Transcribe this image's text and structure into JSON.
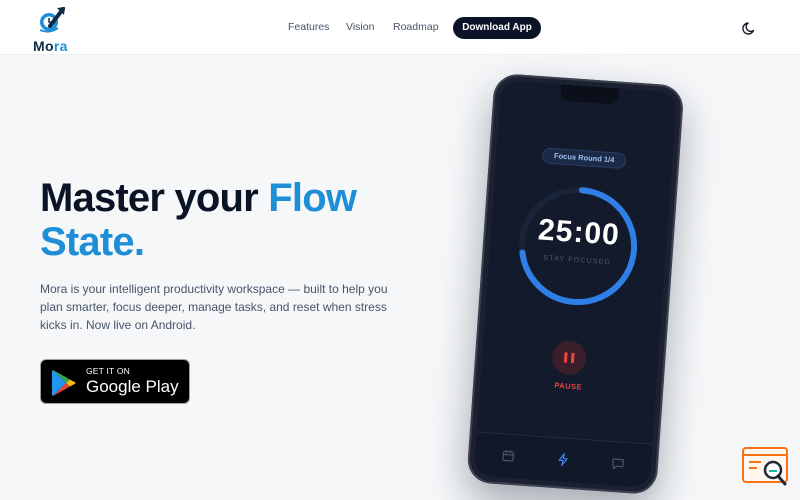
{
  "brand": {
    "name_main": "Mo",
    "name_accent": "ra"
  },
  "nav": {
    "items": [
      "Features",
      "Vision",
      "Roadmap"
    ],
    "cta": "Download App"
  },
  "hero": {
    "title_part1": "Master your ",
    "title_flow": "Flow",
    "title_state": "State",
    "title_dot": ".",
    "description": "Mora is your intelligent productivity workspace — built to help you plan smarter, focus deeper, manage tasks, and reset when stress kicks in. Now live on Android.",
    "store_small": "GET IT ON",
    "store_big": "Google Play"
  },
  "phone": {
    "round_label": "Focus Round 1/4",
    "timer": "25:00",
    "status": "STAY FOCUSED",
    "pause_label": "PAUSE",
    "progress": 0.72,
    "tabs": [
      "calendar-icon",
      "bolt-icon",
      "chat-icon"
    ]
  },
  "colors": {
    "accent": "#1e8fd6",
    "dark": "#0b1426",
    "danger": "#ef4444"
  }
}
